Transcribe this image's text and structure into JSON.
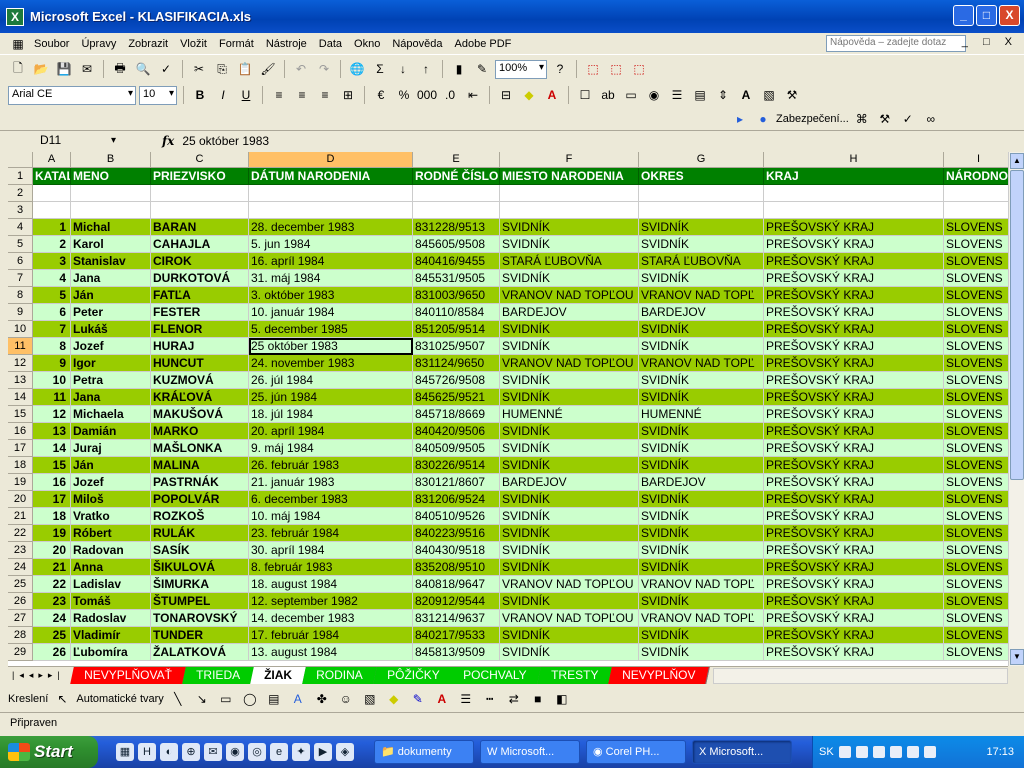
{
  "window": {
    "title": "Microsoft Excel - KLASIFIKACIA.xls",
    "controls": [
      "_",
      "□",
      "X"
    ]
  },
  "menu": {
    "items": [
      "Soubor",
      "Úpravy",
      "Zobrazit",
      "Vložit",
      "Formát",
      "Nástroje",
      "Data",
      "Okno",
      "Nápověda",
      "Adobe PDF"
    ],
    "help_placeholder": "Nápověda – zadejte dotaz"
  },
  "toolbar": {
    "zoom": "100%",
    "font": "Arial CE",
    "font_size": "10",
    "security_label": "Zabezpečení..."
  },
  "formula_bar": {
    "name_box": "D11",
    "fx": "fx",
    "value": "25 október 1983"
  },
  "columns": [
    "A",
    "B",
    "C",
    "D",
    "E",
    "F",
    "G",
    "H",
    "I"
  ],
  "header_row": [
    "KATAL",
    "MENO",
    "PRIEZVISKO",
    "DÁTUM NARODENIA",
    "RODNÉ ČÍSLO",
    "MIESTO NARODENIA",
    "OKRES",
    "KRAJ",
    "NÁRODNO"
  ],
  "rows": [
    [
      "1",
      "Michal",
      "BARAN",
      "28. december 1983",
      "831228/9513",
      "SVIDNÍK",
      "SVIDNÍK",
      "PREŠOVSKÝ KRAJ",
      "SLOVENS"
    ],
    [
      "2",
      "Karol",
      "CAHAJLA",
      "5. jun 1984",
      "845605/9508",
      "SVIDNÍK",
      "SVIDNÍK",
      "PREŠOVSKÝ KRAJ",
      "SLOVENS"
    ],
    [
      "3",
      "Stanislav",
      "CIROK",
      "16. apríl 1984",
      "840416/9455",
      "STARÁ ĽUBOVŇA",
      "STARÁ ĽUBOVŇA",
      "PREŠOVSKÝ KRAJ",
      "SLOVENS"
    ],
    [
      "4",
      "Jana",
      "DURKOTOVÁ",
      "31. máj 1984",
      "845531/9505",
      "SVIDNÍK",
      "SVIDNÍK",
      "PREŠOVSKÝ KRAJ",
      "SLOVENS"
    ],
    [
      "5",
      "Ján",
      "FATĽA",
      "3. október 1983",
      "831003/9650",
      "VRANOV NAD TOPĽOU",
      "VRANOV NAD TOPĽ",
      "PREŠOVSKÝ KRAJ",
      "SLOVENS"
    ],
    [
      "6",
      "Peter",
      "FESTER",
      "10. január 1984",
      "840110/8584",
      "BARDEJOV",
      "BARDEJOV",
      "PREŠOVSKÝ KRAJ",
      "SLOVENS"
    ],
    [
      "7",
      "Lukáš",
      "FLENOR",
      "5. december 1985",
      "851205/9514",
      "SVIDNÍK",
      "SVIDNÍK",
      "PREŠOVSKÝ KRAJ",
      "SLOVENS"
    ],
    [
      "8",
      "Jozef",
      "HURAJ",
      "25 október 1983",
      "831025/9507",
      "SVIDNÍK",
      "SVIDNÍK",
      "PREŠOVSKÝ KRAJ",
      "SLOVENS"
    ],
    [
      "9",
      "Igor",
      "HUNCUT",
      "24. november 1983",
      "831124/9650",
      "VRANOV NAD TOPĽOU",
      "VRANOV NAD TOPĽ",
      "PREŠOVSKÝ KRAJ",
      "SLOVENS"
    ],
    [
      "10",
      "Petra",
      "KUZMOVÁ",
      "26. júl 1984",
      "845726/9508",
      "SVIDNÍK",
      "SVIDNÍK",
      "PREŠOVSKÝ KRAJ",
      "SLOVENS"
    ],
    [
      "11",
      "Jana",
      "KRÁĽOVÁ",
      "25. jún 1984",
      "845625/9521",
      "SVIDNÍK",
      "SVIDNÍK",
      "PREŠOVSKÝ KRAJ",
      "SLOVENS"
    ],
    [
      "12",
      "Michaela",
      "MAKUŠOVÁ",
      "18. júl 1984",
      "845718/8669",
      "HUMENNÉ",
      "HUMENNÉ",
      "PREŠOVSKÝ KRAJ",
      "SLOVENS"
    ],
    [
      "13",
      "Damián",
      "MARKO",
      "20. apríl 1984",
      "840420/9506",
      "SVIDNÍK",
      "SVIDNÍK",
      "PREŠOVSKÝ KRAJ",
      "SLOVENS"
    ],
    [
      "14",
      "Juraj",
      "MAŠLONKA",
      "9. máj 1984",
      "840509/9505",
      "SVIDNÍK",
      "SVIDNÍK",
      "PREŠOVSKÝ KRAJ",
      "SLOVENS"
    ],
    [
      "15",
      "Ján",
      "MALINA",
      "26. február 1983",
      "830226/9514",
      "SVIDNÍK",
      "SVIDNÍK",
      "PREŠOVSKÝ KRAJ",
      "SLOVENS"
    ],
    [
      "16",
      "Jozef",
      "PASTRNÁK",
      "21. január 1983",
      "830121/8607",
      "BARDEJOV",
      "BARDEJOV",
      "PREŠOVSKÝ KRAJ",
      "SLOVENS"
    ],
    [
      "17",
      "Miloš",
      "POPOLVÁR",
      "6. december 1983",
      "831206/9524",
      "SVIDNÍK",
      "SVIDNÍK",
      "PREŠOVSKÝ KRAJ",
      "SLOVENS"
    ],
    [
      "18",
      "Vratko",
      "ROZKOŠ",
      "10. máj 1984",
      "840510/9526",
      "SVIDNÍK",
      "SVIDNÍK",
      "PREŠOVSKÝ KRAJ",
      "SLOVENS"
    ],
    [
      "19",
      "Róbert",
      "RULÁK",
      "23. február 1984",
      "840223/9516",
      "SVIDNÍK",
      "SVIDNÍK",
      "PREŠOVSKÝ KRAJ",
      "SLOVENS"
    ],
    [
      "20",
      "Radovan",
      "SASÍK",
      "30. apríl 1984",
      "840430/9518",
      "SVIDNÍK",
      "SVIDNÍK",
      "PREŠOVSKÝ KRAJ",
      "SLOVENS"
    ],
    [
      "21",
      "Anna",
      "ŠIKULOVÁ",
      "8. február 1983",
      "835208/9510",
      "SVIDNÍK",
      "SVIDNÍK",
      "PREŠOVSKÝ KRAJ",
      "SLOVENS"
    ],
    [
      "22",
      "Ladislav",
      "ŠIMURKA",
      "18. august 1984",
      "840818/9647",
      "VRANOV NAD TOPĽOU",
      "VRANOV NAD TOPĽ",
      "PREŠOVSKÝ KRAJ",
      "SLOVENS"
    ],
    [
      "23",
      "Tomáš",
      "ŠTUMPEL",
      "12. september 1982",
      "820912/9544",
      "SVIDNÍK",
      "SVIDNÍK",
      "PREŠOVSKÝ KRAJ",
      "SLOVENS"
    ],
    [
      "24",
      "Radoslav",
      "TONAROVSKÝ",
      "14. december 1983",
      "831214/9637",
      "VRANOV NAD TOPĽOU",
      "VRANOV NAD TOPĽ",
      "PREŠOVSKÝ KRAJ",
      "SLOVENS"
    ],
    [
      "25",
      "Vladimír",
      "TUNDER",
      "17. február 1984",
      "840217/9533",
      "SVIDNÍK",
      "SVIDNÍK",
      "PREŠOVSKÝ KRAJ",
      "SLOVENS"
    ],
    [
      "26",
      "Ľubomíra",
      "ŽALATKOVÁ",
      "13. august 1984",
      "845813/9509",
      "SVIDNÍK",
      "SVIDNÍK",
      "PREŠOVSKÝ KRAJ",
      "SLOVENS"
    ]
  ],
  "sheet_tabs": [
    {
      "label": "NEVYPLŇOVAŤ",
      "color": "#ff0000"
    },
    {
      "label": "TRIEDA",
      "color": "#00cc00"
    },
    {
      "label": "ŽIAK",
      "color": "#ffffff"
    },
    {
      "label": "RODINA",
      "color": "#00cc00"
    },
    {
      "label": "PÔŽIČKY",
      "color": "#00cc00"
    },
    {
      "label": "POCHVALY",
      "color": "#00cc00"
    },
    {
      "label": "TRESTY",
      "color": "#00cc00"
    },
    {
      "label": "NEVYPLŇOV",
      "color": "#ff0000"
    }
  ],
  "active_tab": "ŽIAK",
  "drawing": {
    "draw_label": "Kreslení",
    "autoshapes_label": "Automatické tvary"
  },
  "status": {
    "text": "Připraven"
  },
  "taskbar": {
    "start_label": "Start",
    "buttons": [
      "dokumenty",
      "Microsoft...",
      "Corel PH...",
      "Microsoft..."
    ],
    "active_button": 3,
    "lang": "SK",
    "clock": "17:13"
  },
  "colors": {
    "header_green": "#008000",
    "row_dark": "#99cc00",
    "row_light": "#ccffcc",
    "active_header": "#ffc066"
  }
}
